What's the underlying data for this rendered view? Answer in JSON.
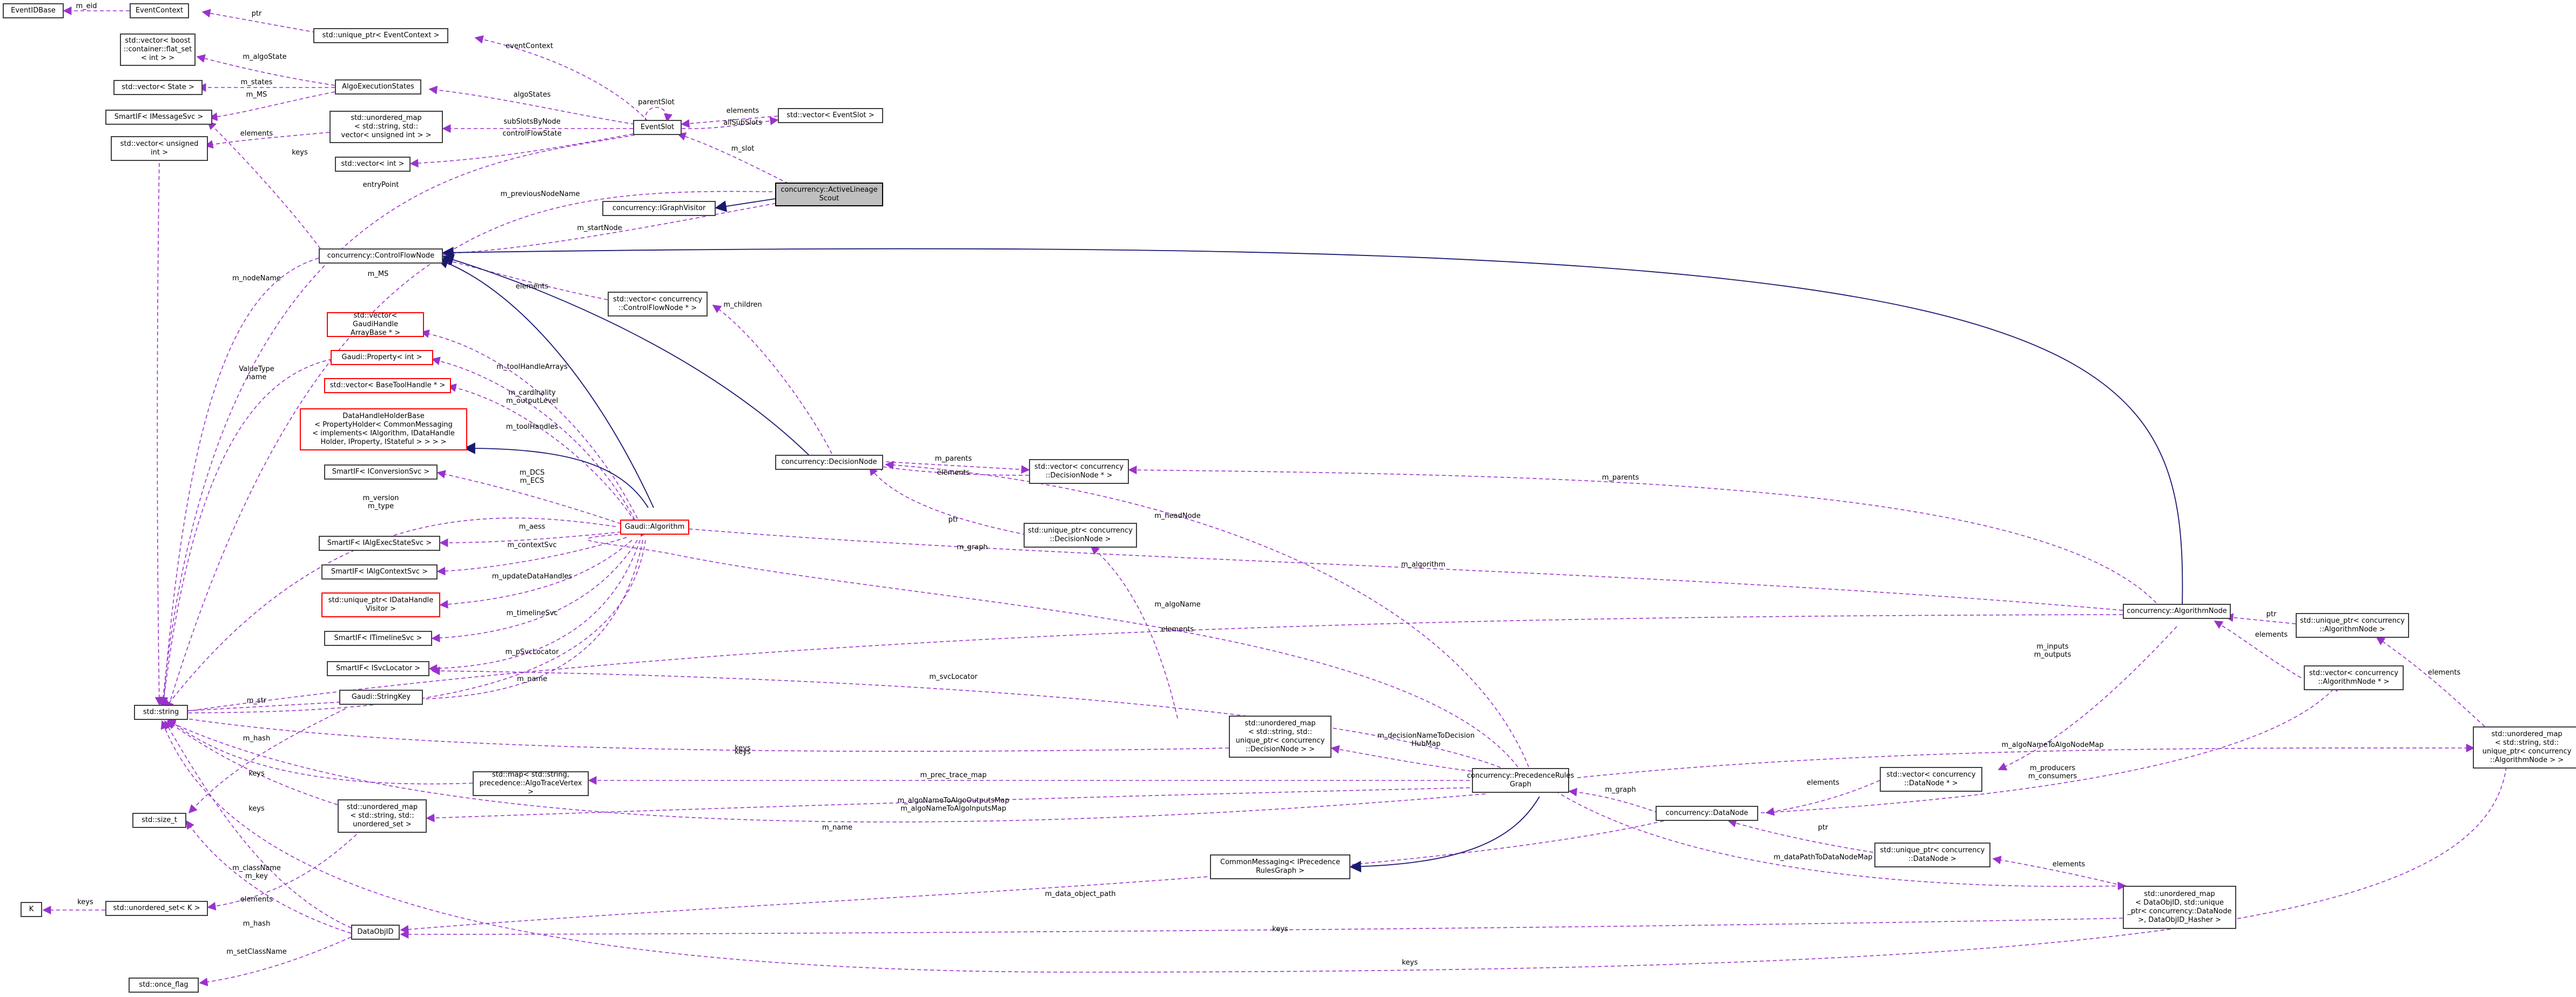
{
  "colors": {
    "usage_edge": "#9a32cd",
    "inherit_edge": "#191970",
    "focus_fill": "#bfbfbf",
    "undocumented_border": "#ff0000",
    "node_border": "#404040"
  },
  "nodes": {
    "eventidbase": "EventIDBase",
    "eventcontext": "EventContext",
    "vector_boost_flatset": "std::vector< boost\n::container::flat_set\n< int > >",
    "vector_state": "std::vector< State >",
    "smartif_imessagesvc": "SmartIF< IMessageSvc >",
    "vector_unsigned_int": "std::vector< unsigned\nint >",
    "unique_ptr_eventcontext": "std::unique_ptr< EventContext >",
    "algoexecutionstates": "AlgoExecutionStates",
    "unordered_map_string_vector_uint": "std::unordered_map\n< std::string, std::\nvector< unsigned int > >",
    "vector_int": "std::vector< int >",
    "eventslot": "EventSlot",
    "vector_eventslot": "std::vector< EventSlot >",
    "activelineagescout": "concurrency::ActiveLineage\nScout",
    "igraphvisitor": "concurrency::IGraphVisitor",
    "controlflownode": "concurrency::ControlFlowNode",
    "vector_controlflownode_ptr": "std::vector< concurrency\n::ControlFlowNode * >",
    "vector_gaudihandlearraybase": "std::vector< GaudiHandle\nArrayBase * >",
    "gaudi_property_int": "Gaudi::Property< int >",
    "vector_basetoolhandle": "std::vector< BaseToolHandle * >",
    "datahandleholderbase": "DataHandleHolderBase\n< PropertyHolder< CommonMessaging\n< implements< IAlgorithm, IDataHandle\nHolder, IProperty, IStateful > > > >",
    "smartif_iconversionsvc": "SmartIF< IConversionSvc >",
    "gaudi_algorithm": "Gaudi::Algorithm",
    "smartif_ialgexecstatesvc": "SmartIF< IAlgExecStateSvc >",
    "smartif_ialgcontextsvc": "SmartIF< IAlgContextSvc >",
    "unique_ptr_idatahandlevisitor": "std::unique_ptr< IDataHandle\nVisitor >",
    "smartif_itimelinesvc": "SmartIF< ITimelineSvc >",
    "smartif_isvclocator": "SmartIF< ISvcLocator >",
    "gaudi_stringkey": "Gaudi::StringKey",
    "std_string": "std::string",
    "decisionnode": "concurrency::DecisionNode",
    "vector_decisionnode_ptr": "std::vector< concurrency\n::DecisionNode * >",
    "unique_ptr_decisionnode": "std::unique_ptr< concurrency\n::DecisionNode >",
    "algorithmnode": "concurrency::AlgorithmNode",
    "unique_ptr_algorithmnode": "std::unique_ptr< concurrency\n::AlgorithmNode >",
    "vector_algorithmnode_ptr": "std::vector< concurrency\n::AlgorithmNode * >",
    "unordered_map_string_unique_ptr_decisionnode": "std::unordered_map\n< std::string, std::\nunique_ptr< concurrency\n::DecisionNode > >",
    "map_string_algotracevertex": "std::map< std::string,\nprecedence::AlgoTraceVertex >",
    "size_t": "std::size_t",
    "unordered_map_string_unordered_set": "std::unordered_map\n< std::string, std::\nunordered_set >",
    "k": "K",
    "unordered_set_k": "std::unordered_set< K >",
    "precedencerulesgraph": "concurrency::PrecedenceRules\nGraph",
    "iprecedencerulesgraph": "CommonMessaging< IPrecedence\nRulesGraph >",
    "vector_datanode_ptr": "std::vector< concurrency\n::DataNode * >",
    "datanode": "concurrency::DataNode",
    "unique_ptr_datanode": "std::unique_ptr< concurrency\n::DataNode >",
    "unordered_map_string_unique_ptr_algorithmnode": "std::unordered_map\n< std::string, std::\nunique_ptr< concurrency\n::AlgorithmNode > >",
    "dataobjid": "DataObjID",
    "unordered_map_dataobjid_unique_ptr_datanode": "std::unordered_map\n< DataObjID, std::unique\n_ptr< concurrency::DataNode\n >, DataObjID_Hasher >",
    "once_flag": "std::once_flag"
  },
  "edge_labels": {
    "m_eid": "m_eid",
    "ptr_eventcontext": "ptr",
    "m_algostate": "m_algoState",
    "m_states": "m_states",
    "m_ms_algoexec": "m_MS",
    "elements_vector_uint": "elements",
    "keys_top": "keys",
    "eventcontext": "eventContext",
    "algostates": "algoStates",
    "subslotsbynode": "subSlotsByNode",
    "controlflowstate": "controlFlowState",
    "parentslot": "parentSlot",
    "elements_eventslot": "elements",
    "allsubslots": "allSubSlots",
    "m_slot": "m_slot",
    "entrypoint": "entryPoint",
    "m_previousnodename": "m_previousNodeName",
    "m_startnode": "m_startNode",
    "m_ms_cfn": "m_MS",
    "m_nodename": "m_nodeName",
    "elements_children": "elements",
    "m_children": "m_children",
    "valuetype_name": "ValueType\nname",
    "m_toolhandlearrays": "m_toolHandleArrays",
    "m_cardinality": "m_cardinality\nm_outputLevel",
    "m_toolhandles": "m_toolHandles",
    "m_dcs": "m_DCS\nm_ECS",
    "m_version": "m_version\nm_type",
    "m_aess": "m_aess",
    "m_contextsvc": "m_contextSvc",
    "m_updatedatahandles": "m_updateDataHandles",
    "m_timelinesvc": "m_timelineSvc",
    "m_psvclocator": "m_pSvcLocator",
    "m_name_alg": "m_name",
    "m_str": "m_str",
    "m_hash_stringkey": "m_hash",
    "keys_mid": "keys",
    "m_parents_dn": "m_parents",
    "elements_decision": "elements",
    "ptr_decision": "ptr",
    "m_headnode": "m_headNode",
    "m_graph_an": "m_graph",
    "m_parents_an": "m_parents",
    "m_algorithm": "m_algorithm",
    "m_algoname": "m_algoName",
    "ptr_algnode": "ptr",
    "elements_algnode": "elements",
    "elements_uptr_algnode": "elements",
    "m_svclocator": "m_svcLocator",
    "m_inputs": "m_inputs\nm_outputs",
    "elements_decisionmap": "elements",
    "m_decisionnametodecisionhubmap": "m_decisionNameToDecision\nHubMap",
    "keys_decisionmap": "keys",
    "m_prec_trace_map": "m_prec_trace_map",
    "keys_tracemap": "keys",
    "m_algonametoalgonodemap": "m_algoNameToAlgoNodeMap",
    "m_producers": "m_producers\nm_consumers",
    "m_algonametoalgoinputsmap": "m_algoNameToAlgoOutputsMap\nm_algoNameToAlgoInputsMap",
    "m_name_dn": "m_name",
    "keys_unordset": "keys",
    "elements_datanodes": "elements",
    "m_graph_dn": "m_graph",
    "ptr_datanode": "ptr",
    "m_datapathtodatanodemap": "m_dataPathToDataNodeMap",
    "elements_dnmap": "elements",
    "m_classname": "m_className\nm_key",
    "keys_k": "keys",
    "elements_k": "elements",
    "m_data_object_path": "m_data_object_path",
    "m_hash_dataobjid": "m_hash",
    "keys_dataobjid": "keys",
    "m_setclassname": "m_setClassName",
    "keys_bottom": "keys"
  }
}
